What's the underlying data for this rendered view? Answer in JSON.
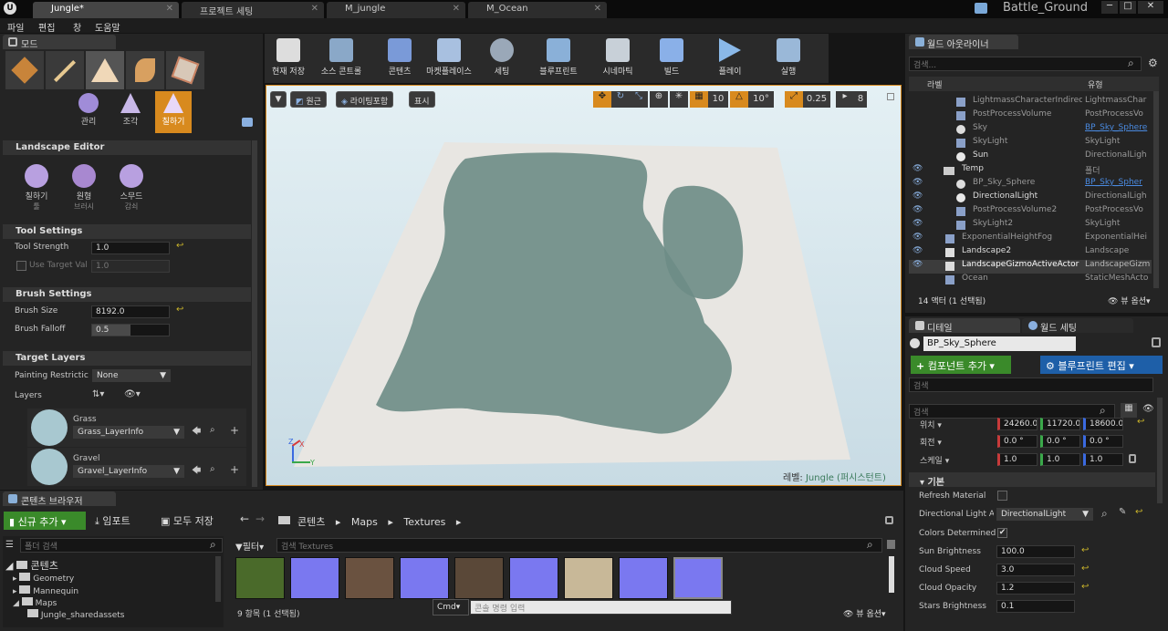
{
  "tabs": [
    {
      "label": "Jungle*"
    },
    {
      "label": "프로젝트 세팅"
    },
    {
      "label": "M_jungle"
    },
    {
      "label": "M_Ocean"
    }
  ],
  "app": {
    "project_name": "Battle_Ground"
  },
  "menu": [
    "파일",
    "편집",
    "창",
    "도움말"
  ],
  "modes": {
    "tab_label": "모드",
    "sub": [
      "관리",
      "조각",
      "칠하기"
    ]
  },
  "landscape": {
    "title": "Landscape Editor",
    "tools": [
      {
        "label": "칠하기",
        "sub": "툴"
      },
      {
        "label": "원형",
        "sub": "브러시"
      },
      {
        "label": "스무드",
        "sub": "감쇠"
      }
    ],
    "tool_settings": {
      "title": "Tool Settings",
      "strength_label": "Tool Strength",
      "strength": "1.0",
      "target_label": "Use Target Val",
      "target": "1.0"
    },
    "brush_settings": {
      "title": "Brush Settings",
      "size_label": "Brush Size",
      "size": "8192.0",
      "falloff_label": "Brush Falloff",
      "falloff": "0.5"
    },
    "target_layers": {
      "title": "Target Layers",
      "restriction_label": "Painting Restrictic",
      "restriction": "None",
      "layers_label": "Layers",
      "layers": [
        {
          "name": "Grass",
          "info": "Grass_LayerInfo"
        },
        {
          "name": "Gravel",
          "info": "Gravel_LayerInfo"
        }
      ]
    }
  },
  "toolbar": [
    {
      "label": "현재 저장"
    },
    {
      "label": "소스 콘트롤"
    },
    {
      "label": "콘텐츠"
    },
    {
      "label": "마켓플레이스"
    },
    {
      "label": "세팅"
    },
    {
      "label": "블루프린트"
    },
    {
      "label": "시네마틱"
    },
    {
      "label": "빌드"
    },
    {
      "label": "플레이"
    },
    {
      "label": "실행"
    }
  ],
  "viewport": {
    "perspective": "원근",
    "lighting": "라이팅포함",
    "show": "표시",
    "grid": "10",
    "rot": "10°",
    "scale": "0.25",
    "speed": "8",
    "level_label": "레벨:",
    "level_name": "Jungle (퍼시스턴트)",
    "axis_z": "Z",
    "axis_x": "X",
    "axis_y": "Y"
  },
  "outliner": {
    "tab": "월드 아웃라이너",
    "search_placeholder": "검색...",
    "col_label": "라벨",
    "col_type": "유형",
    "rows": [
      {
        "label": "LightmassCharacterIndirectDetail",
        "type": "LightmassChar"
      },
      {
        "label": "PostProcessVolume",
        "type": "PostProcessVo"
      },
      {
        "label": "Sky",
        "type": "BP_Sky_Sphere"
      },
      {
        "label": "SkyLight",
        "type": "SkyLight"
      },
      {
        "label": "Sun",
        "type": "DirectionalLigh"
      },
      {
        "label": "Temp",
        "type": "폴더"
      },
      {
        "label": "BP_Sky_Sphere",
        "type": "BP_Sky_Spher"
      },
      {
        "label": "DirectionalLight",
        "type": "DirectionalLigh"
      },
      {
        "label": "PostProcessVolume2",
        "type": "PostProcessVo"
      },
      {
        "label": "SkyLight2",
        "type": "SkyLight"
      },
      {
        "label": "ExponentialHeightFog",
        "type": "ExponentialHei"
      },
      {
        "label": "Landscape2",
        "type": "Landscape"
      },
      {
        "label": "LandscapeGizmoActiveActor",
        "type": "LandscapeGizm"
      },
      {
        "label": "Ocean",
        "type": "StaticMeshActo"
      }
    ],
    "footer": "14 액터 (1 선택됨)",
    "view_options": "뷰 옵션"
  },
  "details": {
    "tab": "디테일",
    "world_tab": "월드 세팅",
    "name": "BP_Sky_Sphere",
    "add_component": "컴포넌트 추가",
    "edit_blueprint": "블루프린트 편집",
    "search_placeholder": "검색",
    "transform": {
      "loc_label": "위치",
      "loc": [
        "24260.0",
        "11720.0",
        "18600.0"
      ],
      "rot_label": "회전",
      "rot": [
        "0.0 °",
        "0.0 °",
        "0.0 °"
      ],
      "scale_label": "스케일",
      "scale": [
        "1.0",
        "1.0",
        "1.0"
      ]
    },
    "section": "기본",
    "props": [
      {
        "label": "Refresh Material",
        "kind": "check",
        "value": ""
      },
      {
        "label": "Directional Light A",
        "kind": "combo",
        "value": "DirectionalLight"
      },
      {
        "label": "Colors Determined",
        "kind": "check",
        "value": "✔"
      },
      {
        "label": "Sun Brightness",
        "kind": "num",
        "value": "100.0"
      },
      {
        "label": "Cloud Speed",
        "kind": "num",
        "value": "3.0"
      },
      {
        "label": "Cloud Opacity",
        "kind": "num",
        "value": "1.2"
      },
      {
        "label": "Stars Brightness",
        "kind": "num",
        "value": "0.1"
      }
    ]
  },
  "content": {
    "tab": "콘텐츠 브라우저",
    "new": "신규 추가",
    "import": "임포트",
    "save_all": "모두 저장",
    "path": [
      "콘텐츠",
      "Maps",
      "Textures"
    ],
    "folder_search": "폴더 검색",
    "filter": "필터",
    "asset_search": "검색 Textures",
    "tree": [
      "콘텐츠",
      "Geometry",
      "Mannequin",
      "Maps",
      "Jungle_sharedassets"
    ],
    "count": "9 항목 (1 선택됨)",
    "view_options": "뷰 옵션",
    "cmd": "Cmd",
    "console_placeholder": "콘솔 명령 입력"
  },
  "colors": {
    "accent": "#d88a1e",
    "green": "#3a8a2a",
    "blue": "#1e5fa8"
  }
}
